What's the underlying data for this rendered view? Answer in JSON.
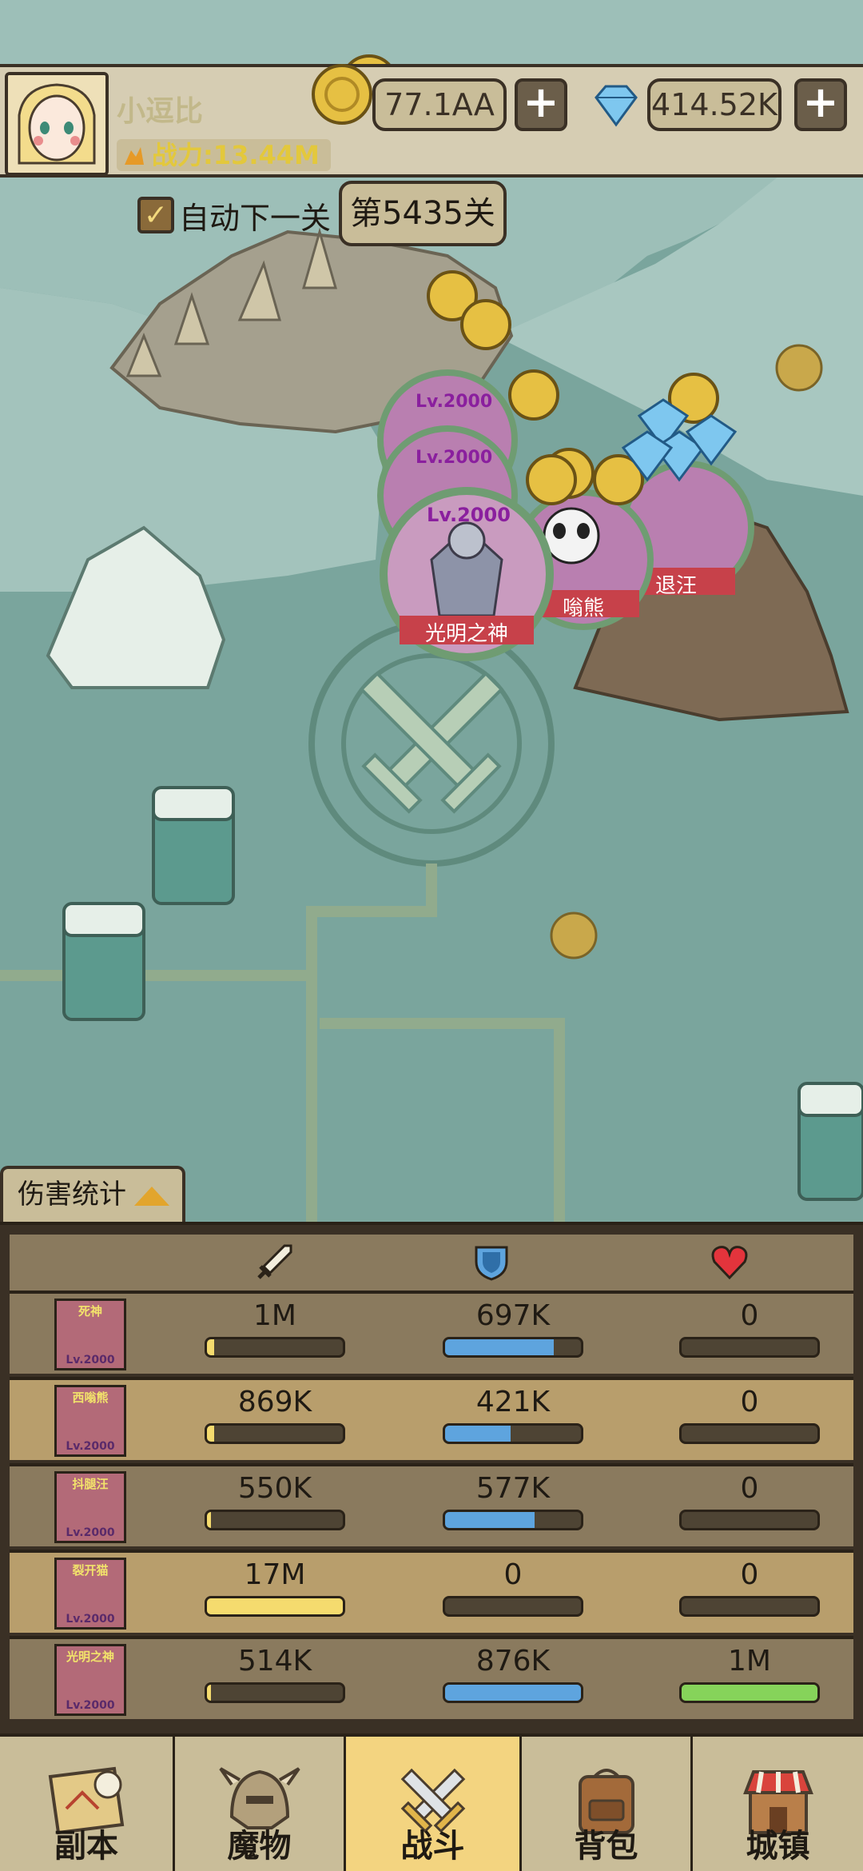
{
  "player": {
    "name": "小逗比",
    "power": "战力:13.44M"
  },
  "currency": {
    "gold": "77.1AA",
    "diamond": "414.52K"
  },
  "stage": {
    "auto_next_label": "自动下一关",
    "auto_next_checked": true,
    "stage_label": "第5435关"
  },
  "battle": {
    "units": [
      {
        "level": "Lv.2000",
        "name": ""
      },
      {
        "level": "Lv.2000",
        "name": ""
      },
      {
        "level": "Lv.2000",
        "name": "光明之神"
      },
      {
        "level": "",
        "name": "嗡熊"
      },
      {
        "level": "",
        "name": "退汪"
      }
    ]
  },
  "damage_tab_label": "伤害统计",
  "stats": {
    "headers": [
      "sword-icon",
      "shield-icon",
      "heart-icon"
    ],
    "rows": [
      {
        "hero": "死神",
        "level": "Lv.2000",
        "damage": "1M",
        "damage_pct": 0.05,
        "tank": "697K",
        "tank_pct": 0.8,
        "heal": "0",
        "heal_pct": 0.0
      },
      {
        "hero": "西嗡熊",
        "level": "Lv.2000",
        "damage": "869K",
        "damage_pct": 0.05,
        "tank": "421K",
        "tank_pct": 0.48,
        "heal": "0",
        "heal_pct": 0.0
      },
      {
        "hero": "抖腿汪",
        "level": "Lv.2000",
        "damage": "550K",
        "damage_pct": 0.03,
        "tank": "577K",
        "tank_pct": 0.66,
        "heal": "0",
        "heal_pct": 0.0
      },
      {
        "hero": "裂开猫",
        "level": "Lv.2000",
        "damage": "17M",
        "damage_pct": 1.0,
        "tank": "0",
        "tank_pct": 0.0,
        "heal": "0",
        "heal_pct": 0.0
      },
      {
        "hero": "光明之神",
        "level": "Lv.2000",
        "damage": "514K",
        "damage_pct": 0.03,
        "tank": "876K",
        "tank_pct": 1.0,
        "heal": "1M",
        "heal_pct": 1.0
      }
    ]
  },
  "nav": {
    "items": [
      {
        "label": "副本",
        "icon": "map-scroll-icon"
      },
      {
        "label": "魔物",
        "icon": "monster-helmet-icon"
      },
      {
        "label": "战斗",
        "icon": "crossed-swords-icon",
        "active": true
      },
      {
        "label": "背包",
        "icon": "backpack-icon"
      },
      {
        "label": "城镇",
        "icon": "town-shop-icon"
      }
    ]
  },
  "colors": {
    "damage_bar": "#f5db6e",
    "tank_bar": "#5ea4de",
    "heal_bar": "#86d35a",
    "nav_active": "#f3d480"
  }
}
